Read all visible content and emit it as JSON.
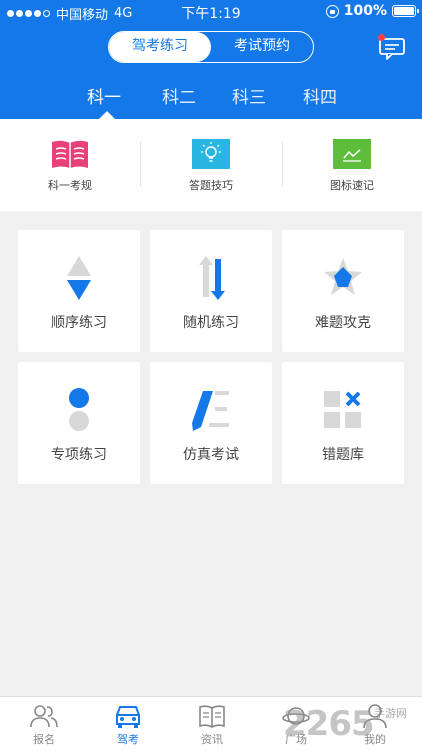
{
  "status_bar": {
    "carrier": "中国移动",
    "network": "4G",
    "time": "下午1:19",
    "battery": "100%"
  },
  "header": {
    "segment": [
      {
        "label": "驾考练习",
        "active": true
      },
      {
        "label": "考试预约",
        "active": false
      }
    ],
    "subject_tabs": [
      {
        "label": "科一",
        "active": true
      },
      {
        "label": "科二",
        "active": false
      },
      {
        "label": "科三",
        "active": false
      },
      {
        "label": "科四",
        "active": false
      }
    ],
    "message_icon": "chat-bubble-icon"
  },
  "quick_links": [
    {
      "label": "科一考规",
      "icon": "book-icon",
      "color": "#e8417a"
    },
    {
      "label": "答题技巧",
      "icon": "lightbulb-icon",
      "color": "#29b6e0"
    },
    {
      "label": "图标速记",
      "icon": "chart-icon",
      "color": "#5ebd3a"
    }
  ],
  "practice_modes": [
    {
      "label": "顺序练习",
      "icon": "order-arrows-icon"
    },
    {
      "label": "随机练习",
      "icon": "shuffle-arrows-icon"
    },
    {
      "label": "难题攻克",
      "icon": "star-icon"
    },
    {
      "label": "专项练习",
      "icon": "dots-stack-icon"
    },
    {
      "label": "仿真考试",
      "icon": "pen-lines-icon"
    },
    {
      "label": "错题库",
      "icon": "grid-x-icon"
    }
  ],
  "bottom_nav": [
    {
      "label": "报名",
      "icon": "people-icon",
      "active": false
    },
    {
      "label": "驾考",
      "icon": "car-icon",
      "active": true
    },
    {
      "label": "资讯",
      "icon": "open-book-icon",
      "active": false
    },
    {
      "label": "广场",
      "icon": "planet-icon",
      "active": false
    },
    {
      "label": "我的",
      "icon": "person-icon",
      "active": false
    }
  ],
  "watermark": {
    "number": "2265",
    "site": "手游网"
  },
  "colors": {
    "primary": "#1478e8",
    "accent_gray": "#d8d8d8"
  }
}
